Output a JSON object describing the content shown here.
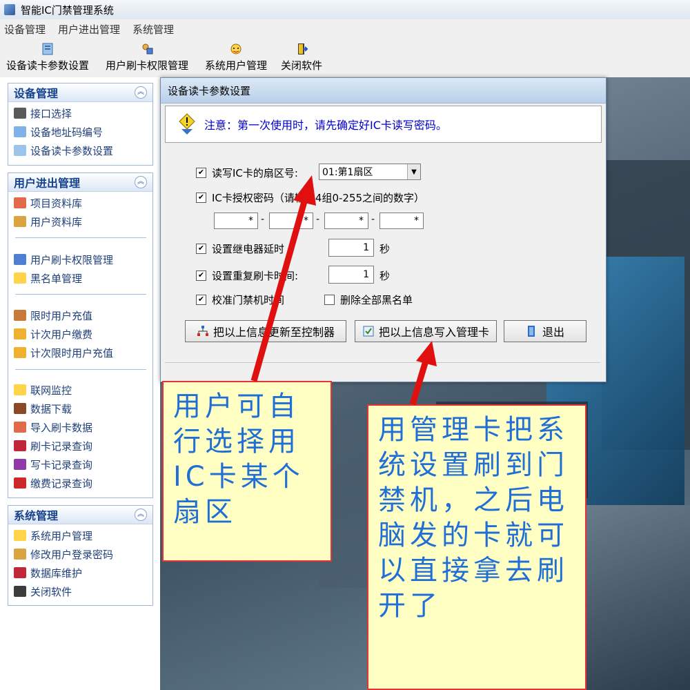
{
  "window": {
    "title": "智能IC门禁管理系统"
  },
  "menubar": [
    "设备管理",
    "用户进出管理",
    "系统管理"
  ],
  "toolbar": [
    {
      "label": "设备读卡参数设置",
      "icon": "card-reader-icon"
    },
    {
      "label": "用户刷卡权限管理",
      "icon": "user-permission-icon"
    },
    {
      "label": "系统用户管理",
      "icon": "user-face-icon"
    },
    {
      "label": "关闭软件",
      "icon": "exit-door-icon"
    }
  ],
  "sidebar": {
    "groups": [
      {
        "title": "设备管理",
        "items": [
          "接口选择",
          "设备地址码编号",
          "设备读卡参数设置"
        ]
      },
      {
        "title": "用户进出管理",
        "items": [
          "项目资料库",
          "用户资料库",
          "用户刷卡权限管理",
          "黑名单管理",
          "限时用户充值",
          "计次用户缴费",
          "计次限时用户充值",
          "联网监控",
          "数据下载",
          "导入刷卡数据",
          "刷卡记录查询",
          "写卡记录查询",
          "缴费记录查询"
        ]
      },
      {
        "title": "系统管理",
        "items": [
          "系统用户管理",
          "修改用户登录密码",
          "数据库维护",
          "关闭软件"
        ]
      }
    ]
  },
  "dialog": {
    "title": "设备读卡参数设置",
    "notice": "注意：第一次使用时，请先确定好IC卡读写密码。",
    "sector_label": "读写IC卡的扇区号:",
    "sector_value": "01:第1扇区",
    "password_label": "IC卡授权密码（请输入4组0-255之间的数字）",
    "password_fields": [
      "*",
      "*",
      "*",
      "*"
    ],
    "relay_label": "设置继电器延时",
    "relay_value": "1",
    "relay_unit": "秒",
    "repeat_label": "设置重复刷卡时间:",
    "repeat_value": "1",
    "repeat_unit": "秒",
    "calibrate_label": "校准门禁机时间",
    "delete_blacklist_label": "删除全部黑名单",
    "checkbox_mark": "✔",
    "buttons": {
      "update_controller": "把以上信息更新至控制器",
      "write_card": "把以上信息写入管理卡",
      "exit": "退出"
    }
  },
  "callouts": {
    "left": "用户可自行选择用IC卡某个扇区",
    "right": "用管理卡把系统设置刷到门禁机，之后电脑发的卡就可以直接拿去刷开了"
  },
  "colors": {
    "callout_text": "#1f6fd6",
    "arrow": "#e01010",
    "notice_text": "#0000cc"
  }
}
